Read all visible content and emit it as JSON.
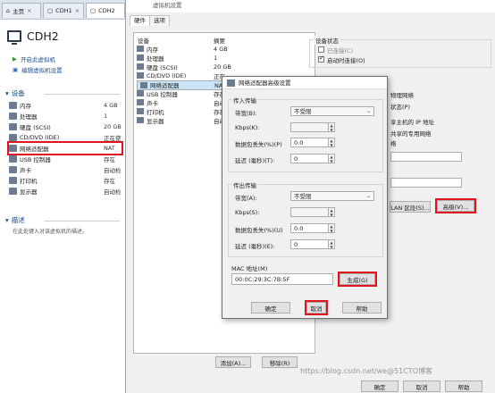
{
  "left": {
    "tabs": [
      {
        "label": "主页"
      },
      {
        "label": "CDH1"
      },
      {
        "label": "CDH2"
      }
    ],
    "vm_name": "CDH2",
    "actions": [
      {
        "label": "开启此虚拟机"
      },
      {
        "label": "编辑虚拟机设置"
      }
    ],
    "devices_header": "设备",
    "devices": [
      {
        "name": "内存",
        "value": "4 GB"
      },
      {
        "name": "处理器",
        "value": "1"
      },
      {
        "name": "硬盘 (SCSI)",
        "value": "20 GB"
      },
      {
        "name": "CD/DVD (IDE)",
        "value": "正在使"
      },
      {
        "name": "网络适配器",
        "value": "NAT"
      },
      {
        "name": "USB 控制器",
        "value": "存在"
      },
      {
        "name": "声卡",
        "value": "自动检"
      },
      {
        "name": "打印机",
        "value": "存在"
      },
      {
        "name": "显示器",
        "value": "自动检"
      }
    ],
    "desc_header": "描述",
    "desc_text": "在此处键入对该虚拟机的描述。"
  },
  "settings": {
    "title": "虚拟机设置",
    "tabs": [
      {
        "label": "硬件"
      },
      {
        "label": "选项"
      }
    ],
    "col_device": "设备",
    "col_summary": "摘要",
    "rows": [
      {
        "device": "内存",
        "summary": "4 GB"
      },
      {
        "device": "处理器",
        "summary": "1"
      },
      {
        "device": "硬盘 (SCSI)",
        "summary": "20 GB"
      },
      {
        "device": "CD/DVD (IDE)",
        "summary": "正在"
      },
      {
        "device": "网络适配器",
        "summary": "NAT"
      },
      {
        "device": "USB 控制器",
        "summary": "存在"
      },
      {
        "device": "声卡",
        "summary": "自动"
      },
      {
        "device": "打印机",
        "summary": "存在"
      },
      {
        "device": "显示器",
        "summary": "自动"
      }
    ],
    "status_group": "设备状态",
    "connected": "已连接(C)",
    "connect_on_start": "启动时连接(O)",
    "net_text": [
      "物理网络",
      "状态(P)",
      "享主机的 IP 地址",
      "共享的专用网络",
      "络"
    ],
    "lan_btn": "LAN 区段(S)...",
    "advanced_btn": "高级(V)...",
    "add_btn": "添加(A)...",
    "remove_btn": "移除(R)",
    "ok": "确定",
    "cancel": "取消",
    "help": "帮助"
  },
  "advanced": {
    "title": "网络适配器高级设置",
    "incoming": "传入传输",
    "outgoing": "传出传输",
    "bandwidth_label": "带宽(B):",
    "bandwidth_value": "不受限",
    "kbps_label": "Kbps(K):",
    "loss_label": "数据包丢失(%)(P)",
    "loss_value": "0.0",
    "latency_label": "延迟 (毫秒)(T):",
    "latency_value": "0",
    "out_bandwidth_label": "带宽(A):",
    "out_bandwidth_value": "不受限",
    "out_kbps_label": "Kbps(S):",
    "out_loss_label": "数据包丢失(%)(U)",
    "out_loss_value": "0.0",
    "out_latency_label": "延迟 (毫秒)(E):",
    "out_latency_value": "0",
    "mac_label": "MAC 地址(M)",
    "mac_value": "00:0C:29:3C:7B:5F",
    "generate": "生成(G)",
    "ok": "确定",
    "cancel": "取消",
    "help": "帮助"
  },
  "watermark": "https://blog.csdn.net/we@51CTO博客"
}
